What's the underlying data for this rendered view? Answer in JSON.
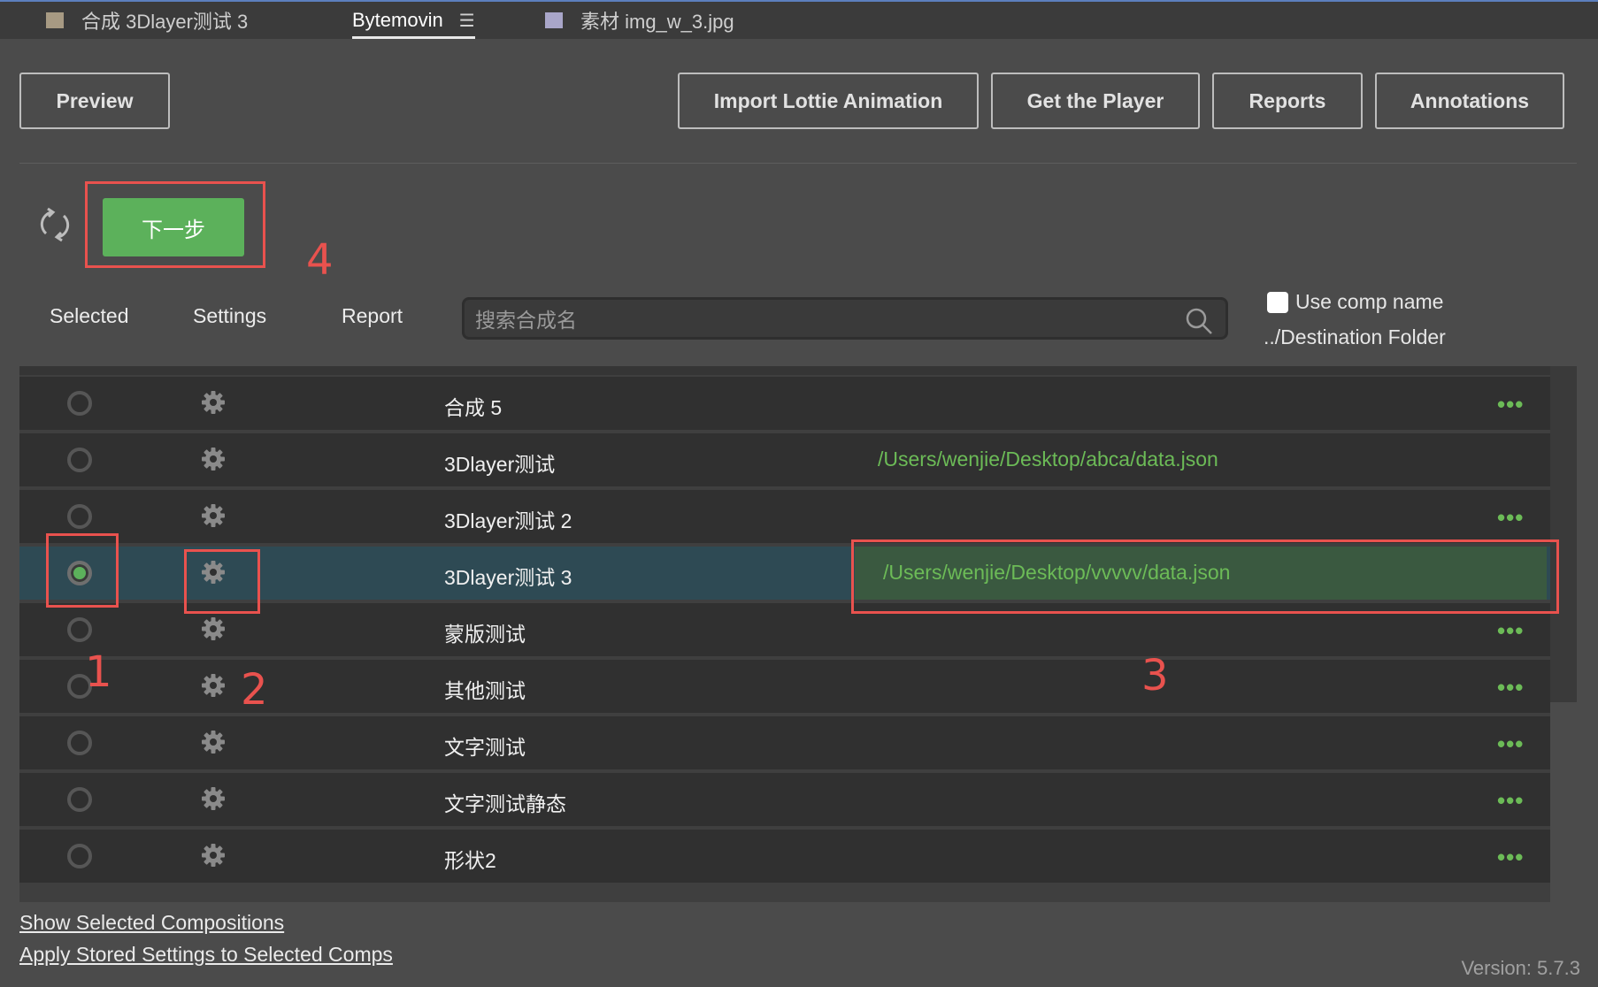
{
  "tabs": [
    {
      "label": "合成 3Dlayer测试 3",
      "swatch": "#a79a83"
    },
    {
      "label": "Bytemovin",
      "menu": "☰",
      "active": true
    },
    {
      "label": "素材 img_w_3.jpg",
      "swatch": "#a9a6c9"
    }
  ],
  "toolbar": {
    "preview": "Preview",
    "import_lottie": "Import Lottie Animation",
    "get_player": "Get the Player",
    "reports": "Reports",
    "annotations": "Annotations"
  },
  "actions": {
    "refresh_icon": "refresh-icon",
    "next_label": "下一步"
  },
  "header": {
    "selected": "Selected",
    "settings": "Settings",
    "report": "Report",
    "search_placeholder": "搜索合成名",
    "use_comp_name": "Use comp name",
    "destination_folder": "../Destination Folder"
  },
  "compositions": [
    {
      "name": "合成 5",
      "path": "",
      "selected": false,
      "more": "•••"
    },
    {
      "name": "3Dlayer测试",
      "path": "/Users/wenjie/Desktop/abca/data.json",
      "selected": false,
      "more": ""
    },
    {
      "name": "3Dlayer测试 2",
      "path": "",
      "selected": false,
      "more": "•••"
    },
    {
      "name": "3Dlayer测试 3",
      "path": "/Users/wenjie/Desktop/vvvvv/data.json",
      "selected": true,
      "more": ""
    },
    {
      "name": "蒙版测试",
      "path": "",
      "selected": false,
      "more": "•••"
    },
    {
      "name": "其他测试",
      "path": "",
      "selected": false,
      "more": "•••"
    },
    {
      "name": "文字测试",
      "path": "",
      "selected": false,
      "more": "•••"
    },
    {
      "name": "文字测试静态",
      "path": "",
      "selected": false,
      "more": "•••"
    },
    {
      "name": "形状2",
      "path": "",
      "selected": false,
      "more": "•••"
    }
  ],
  "annotations": {
    "n1": "1",
    "n2": "2",
    "n3": "3",
    "n4": "4"
  },
  "footer": {
    "show_selected": "Show Selected Compositions",
    "apply_settings": "Apply Stored Settings to Selected Comps",
    "version": "Version: 5.7.3"
  },
  "colors": {
    "accent_green": "#5cb15b",
    "path_green": "#6cbb57",
    "callout_red": "#e9524e",
    "selected_row": "#2e4a54"
  }
}
